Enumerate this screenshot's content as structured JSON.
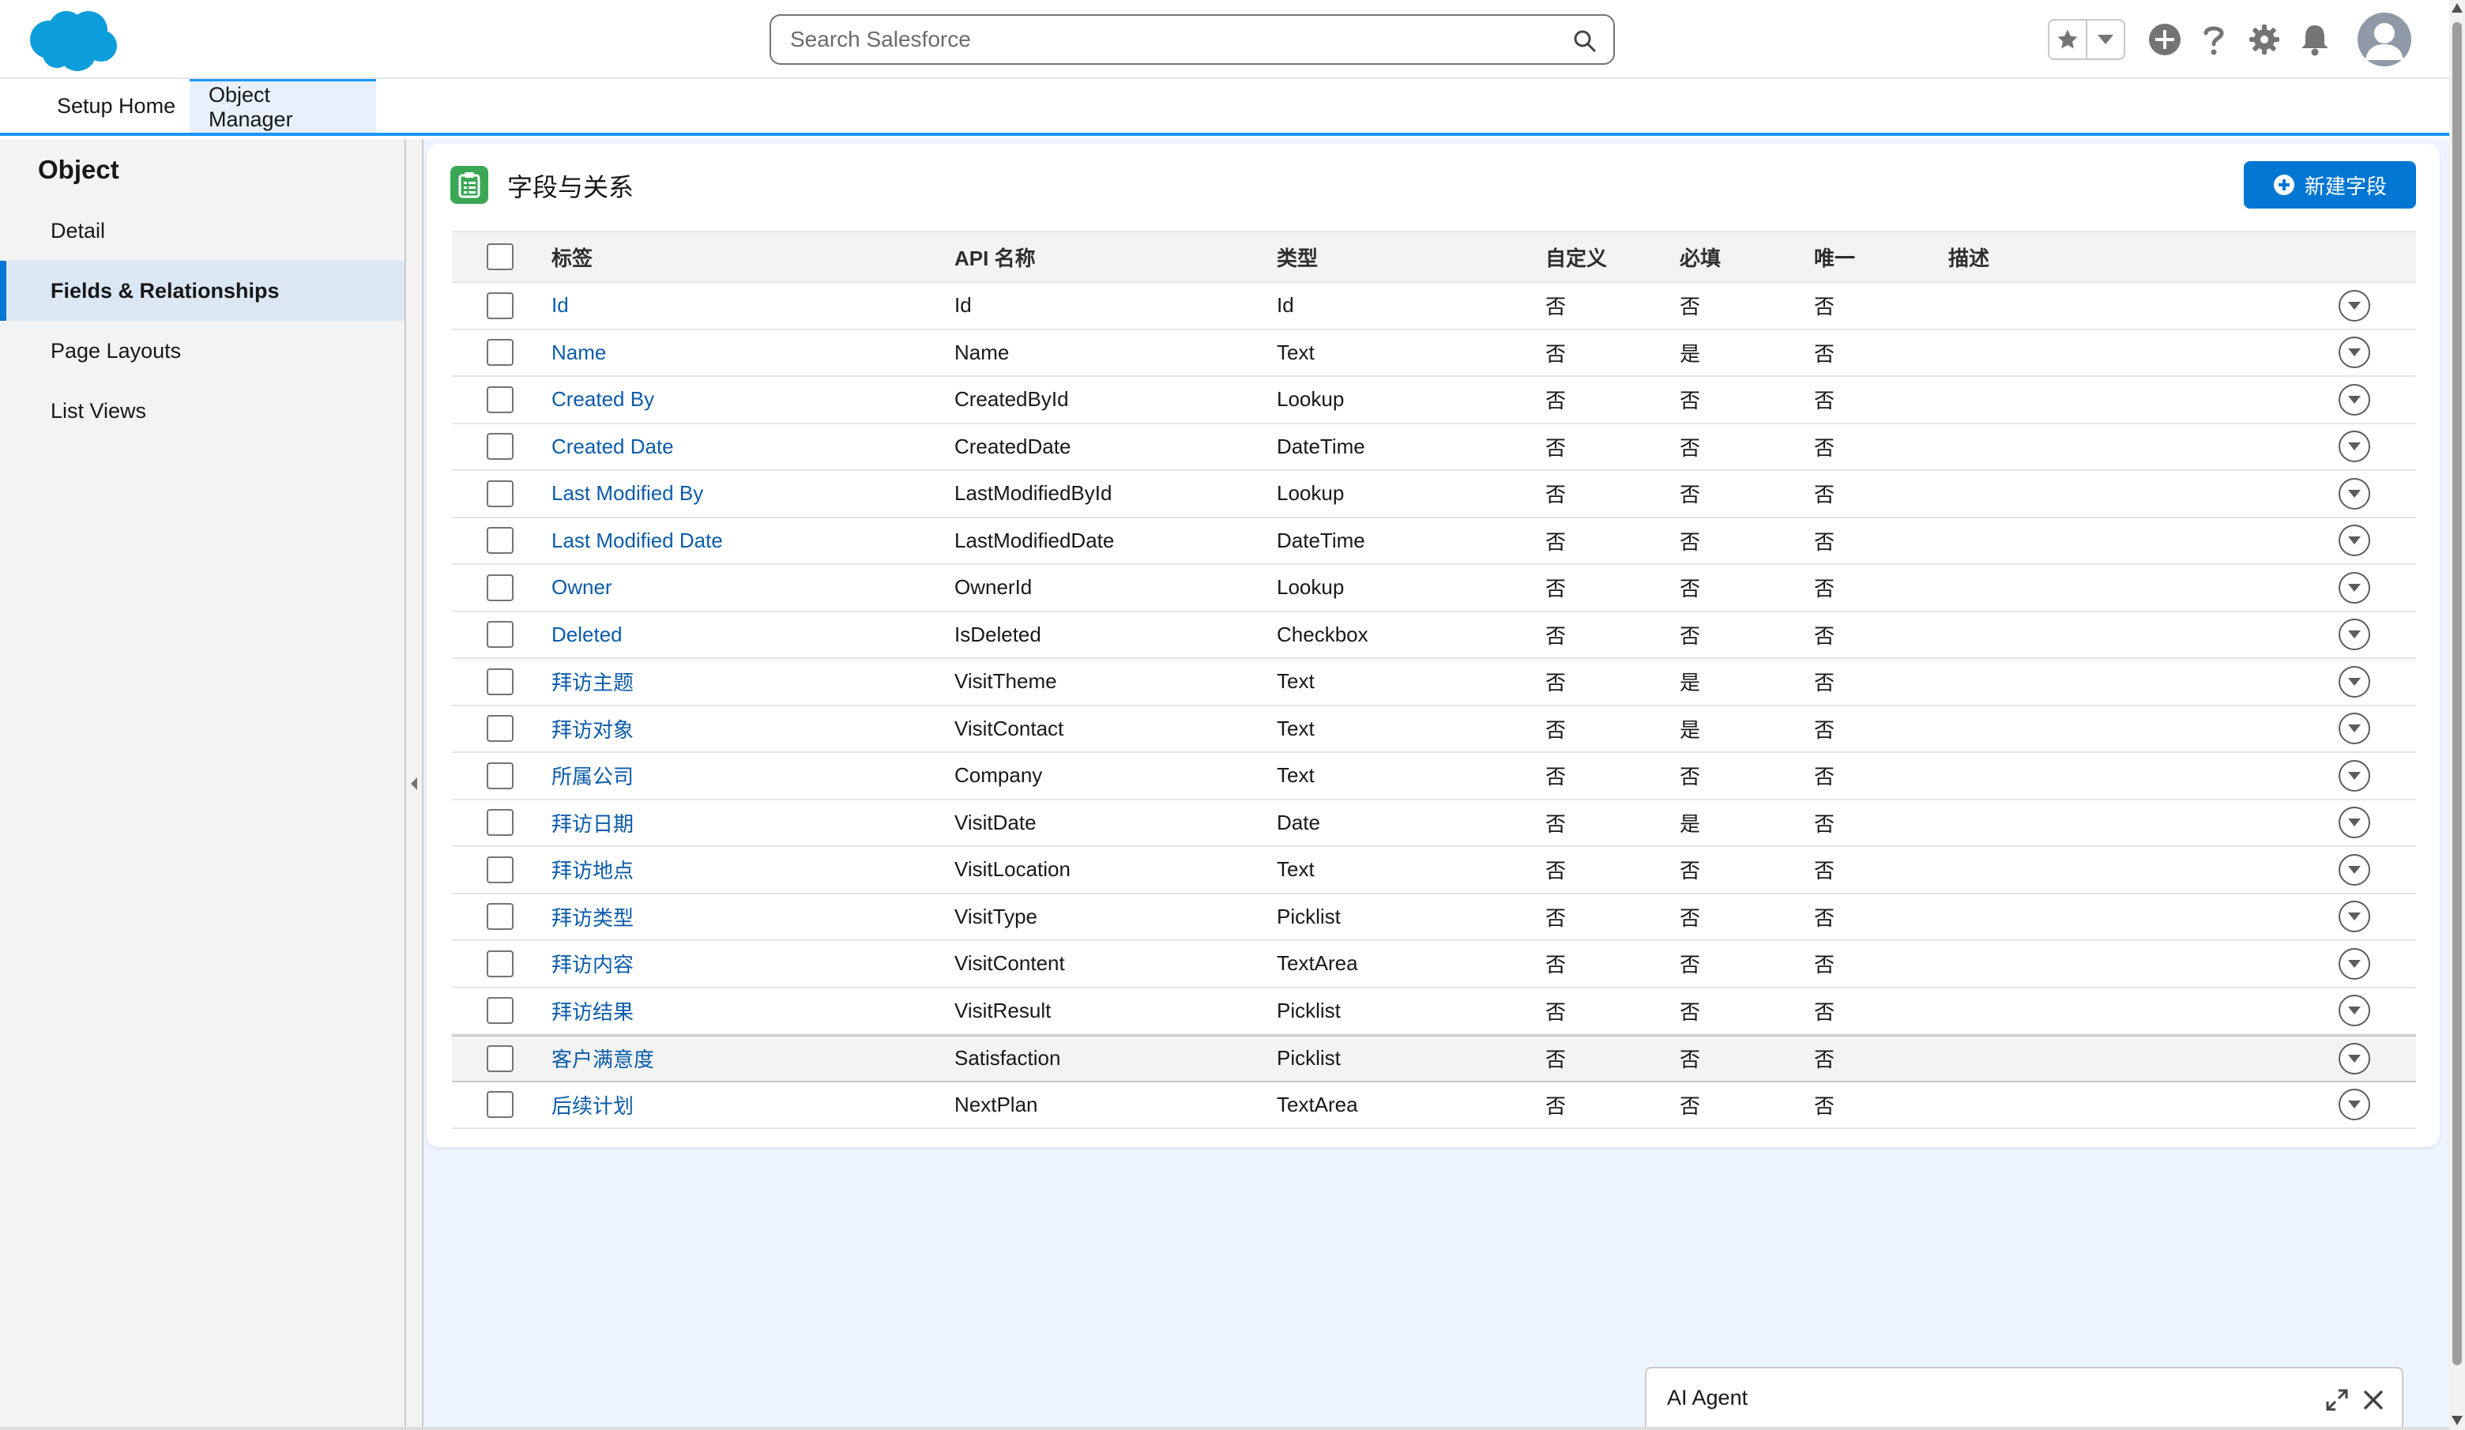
{
  "header": {
    "search_placeholder": "Search Salesforce",
    "icons": [
      "salesforce-logo",
      "favorites-star-icon",
      "favorites-dropdown-icon",
      "global-actions-plus-icon",
      "help-icon",
      "setup-gear-icon",
      "notifications-bell-icon",
      "user-avatar-icon"
    ]
  },
  "nav": {
    "tabs": [
      {
        "label": "Setup Home",
        "active": false
      },
      {
        "label": "Object Manager",
        "active": true
      }
    ]
  },
  "sidebar": {
    "title": "Object",
    "items": [
      {
        "label": "Detail",
        "active": false
      },
      {
        "label": "Fields & Relationships",
        "active": true
      },
      {
        "label": "Page Layouts",
        "active": false
      },
      {
        "label": "List Views",
        "active": false
      }
    ]
  },
  "main": {
    "title": "字段与关系",
    "new_button_label": "新建字段",
    "columns": {
      "label": "标签",
      "api": "API 名称",
      "type": "类型",
      "custom": "自定义",
      "required": "必填",
      "unique": "唯一",
      "description": "描述"
    },
    "rows": [
      {
        "label": "Id",
        "api": "Id",
        "type": "Id",
        "custom": "否",
        "required": "否",
        "unique": "否"
      },
      {
        "label": "Name",
        "api": "Name",
        "type": "Text",
        "custom": "否",
        "required": "是",
        "unique": "否"
      },
      {
        "label": "Created By",
        "api": "CreatedById",
        "type": "Lookup",
        "custom": "否",
        "required": "否",
        "unique": "否"
      },
      {
        "label": "Created Date",
        "api": "CreatedDate",
        "type": "DateTime",
        "custom": "否",
        "required": "否",
        "unique": "否"
      },
      {
        "label": "Last Modified By",
        "api": "LastModifiedById",
        "type": "Lookup",
        "custom": "否",
        "required": "否",
        "unique": "否"
      },
      {
        "label": "Last Modified Date",
        "api": "LastModifiedDate",
        "type": "DateTime",
        "custom": "否",
        "required": "否",
        "unique": "否"
      },
      {
        "label": "Owner",
        "api": "OwnerId",
        "type": "Lookup",
        "custom": "否",
        "required": "否",
        "unique": "否"
      },
      {
        "label": "Deleted",
        "api": "IsDeleted",
        "type": "Checkbox",
        "custom": "否",
        "required": "否",
        "unique": "否"
      },
      {
        "label": "拜访主题",
        "api": "VisitTheme",
        "type": "Text",
        "custom": "否",
        "required": "是",
        "unique": "否"
      },
      {
        "label": "拜访对象",
        "api": "VisitContact",
        "type": "Text",
        "custom": "否",
        "required": "是",
        "unique": "否"
      },
      {
        "label": "所属公司",
        "api": "Company",
        "type": "Text",
        "custom": "否",
        "required": "否",
        "unique": "否"
      },
      {
        "label": "拜访日期",
        "api": "VisitDate",
        "type": "Date",
        "custom": "否",
        "required": "是",
        "unique": "否"
      },
      {
        "label": "拜访地点",
        "api": "VisitLocation",
        "type": "Text",
        "custom": "否",
        "required": "否",
        "unique": "否"
      },
      {
        "label": "拜访类型",
        "api": "VisitType",
        "type": "Picklist",
        "custom": "否",
        "required": "否",
        "unique": "否"
      },
      {
        "label": "拜访内容",
        "api": "VisitContent",
        "type": "TextArea",
        "custom": "否",
        "required": "否",
        "unique": "否"
      },
      {
        "label": "拜访结果",
        "api": "VisitResult",
        "type": "Picklist",
        "custom": "否",
        "required": "否",
        "unique": "否"
      },
      {
        "label": "客户满意度",
        "api": "Satisfaction",
        "type": "Picklist",
        "custom": "否",
        "required": "否",
        "unique": "否",
        "highlighted": true
      },
      {
        "label": "后续计划",
        "api": "NextPlan",
        "type": "TextArea",
        "custom": "否",
        "required": "否",
        "unique": "否"
      }
    ]
  },
  "ai_agent": {
    "title": "AI Agent"
  },
  "colors": {
    "brand_blue": "#0176d3",
    "link_blue": "#0b5cab",
    "logo_blue": "#0d9dda",
    "tab_accent": "#1b96ff",
    "icon_green": "#3ba755"
  }
}
